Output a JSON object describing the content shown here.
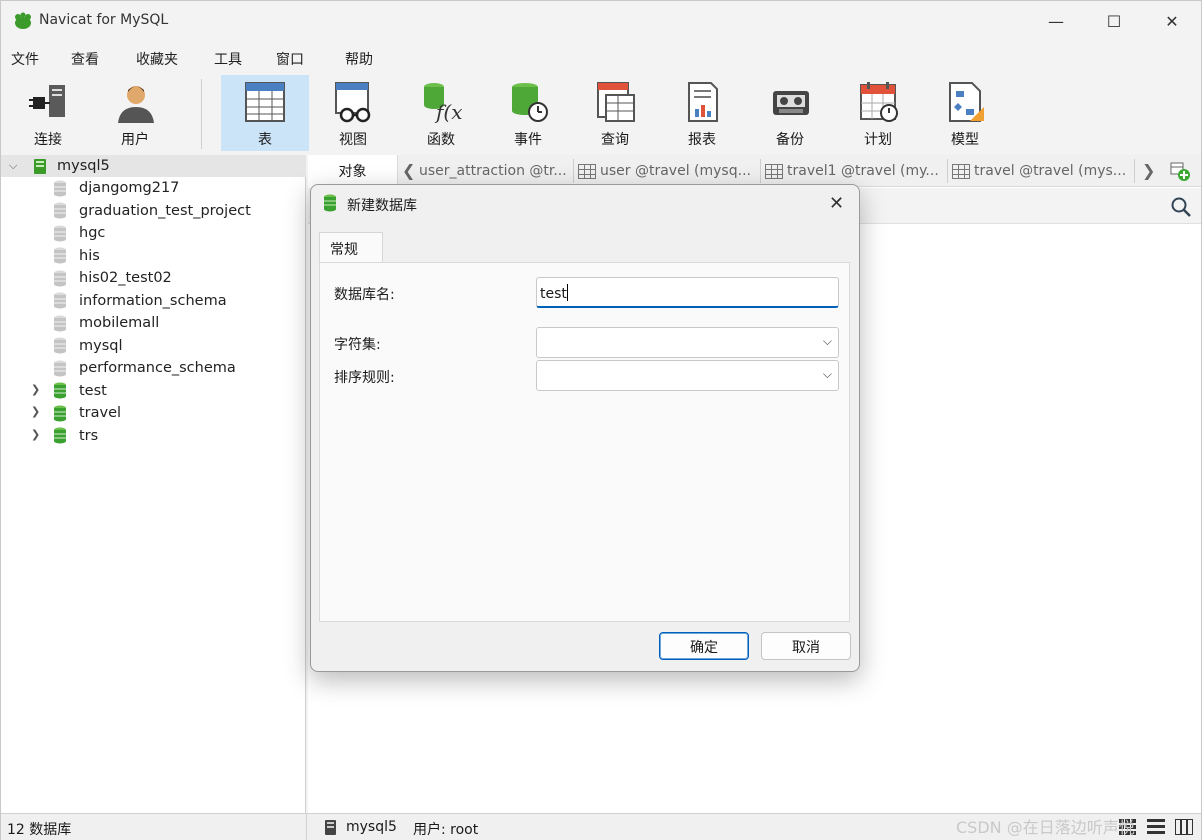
{
  "app": {
    "title": "Navicat for MySQL"
  },
  "window_controls": {
    "minimize": "—",
    "maximize": "☐",
    "close": "✕"
  },
  "menu": [
    "文件",
    "查看",
    "收藏夹",
    "工具",
    "窗口",
    "帮助"
  ],
  "toolbar": [
    {
      "label": "连接",
      "icon": "connection-icon"
    },
    {
      "label": "用户",
      "icon": "user-icon"
    },
    {
      "label": "表",
      "icon": "table-icon",
      "active": true
    },
    {
      "label": "视图",
      "icon": "view-icon"
    },
    {
      "label": "函数",
      "icon": "function-icon"
    },
    {
      "label": "事件",
      "icon": "event-icon"
    },
    {
      "label": "查询",
      "icon": "query-icon"
    },
    {
      "label": "报表",
      "icon": "report-icon"
    },
    {
      "label": "备份",
      "icon": "backup-icon"
    },
    {
      "label": "计划",
      "icon": "schedule-icon"
    },
    {
      "label": "模型",
      "icon": "model-icon"
    }
  ],
  "sidebar": {
    "connection": "mysql5",
    "databases": [
      {
        "name": "djangomg217",
        "open": false
      },
      {
        "name": "graduation_test_project",
        "open": false
      },
      {
        "name": "hgc",
        "open": false
      },
      {
        "name": "his",
        "open": false
      },
      {
        "name": "his02_test02",
        "open": false
      },
      {
        "name": "information_schema",
        "open": false
      },
      {
        "name": "mobilemall",
        "open": false
      },
      {
        "name": "mysql",
        "open": false
      },
      {
        "name": "performance_schema",
        "open": false
      },
      {
        "name": "test",
        "open": true
      },
      {
        "name": "travel",
        "open": true
      },
      {
        "name": "trs",
        "open": true
      }
    ]
  },
  "tabs": {
    "objects": "对象",
    "items": [
      "user_attraction @tr...",
      "user @travel (mysq...",
      "travel1 @travel (my...",
      "travel @travel (mys..."
    ]
  },
  "dialog": {
    "title": "新建数据库",
    "tab": "常规",
    "db_name_label": "数据库名:",
    "db_name_value": "test",
    "charset_label": "字符集:",
    "charset_value": "",
    "collation_label": "排序规则:",
    "collation_value": "",
    "ok": "确定",
    "cancel": "取消"
  },
  "status": {
    "db_count": "12 数据库",
    "connection": "mysql5",
    "user": "用户: root"
  },
  "watermark": "CSDN @在日落边听声悦"
}
